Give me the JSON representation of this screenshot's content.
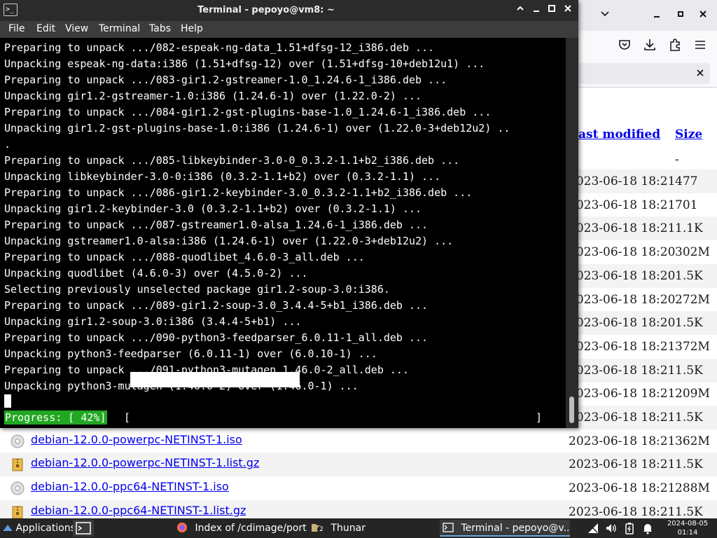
{
  "colors": {
    "terminal_bg": "#000000",
    "terminal_fg": "#ffffff",
    "progress_bg": "#22a722",
    "link": "#0000ee",
    "taskbar_bg": "#252525"
  },
  "browser": {
    "headers": {
      "last_modified": "ast modified",
      "size": "Size"
    },
    "parent_size": "-",
    "rows": [
      {
        "name": "",
        "date": "2023-06-18 18:21",
        "size": "477",
        "icon": "file-icon"
      },
      {
        "name": "",
        "date": "2023-06-18 18:21",
        "size": "701",
        "icon": "file-icon"
      },
      {
        "name": "",
        "date": "2023-06-18 18:21",
        "size": "1.1K",
        "icon": "file-icon"
      },
      {
        "name": "",
        "date": "2023-06-18 18:20",
        "size": "302M",
        "icon": "file-icon"
      },
      {
        "name": "",
        "date": "2023-06-18 18:20",
        "size": "1.5K",
        "icon": "file-icon"
      },
      {
        "name": "",
        "date": "2023-06-18 18:20",
        "size": "272M",
        "icon": "file-icon"
      },
      {
        "name": "",
        "date": "2023-06-18 18:20",
        "size": "1.5K",
        "icon": "file-icon"
      },
      {
        "name": "",
        "date": "2023-06-18 18:21",
        "size": "372M",
        "icon": "file-icon"
      },
      {
        "name": "",
        "date": "2023-06-18 18:21",
        "size": "1.5K",
        "icon": "file-icon"
      },
      {
        "name": "",
        "date": "2023-06-18 18:21",
        "size": "209M",
        "icon": "file-icon"
      },
      {
        "name": "",
        "date": "2023-06-18 18:21",
        "size": "1.5K",
        "icon": "file-icon"
      },
      {
        "name": "debian-12.0.0-powerpc-NETINST-1.iso",
        "date": "2023-06-18 18:21",
        "size": "362M",
        "icon": "disc-icon"
      },
      {
        "name": "debian-12.0.0-powerpc-NETINST-1.list.gz",
        "date": "2023-06-18 18:21",
        "size": "1.5K",
        "icon": "archive-icon"
      },
      {
        "name": "debian-12.0.0-ppc64-NETINST-1.iso",
        "date": "2023-06-18 18:21",
        "size": "288M",
        "icon": "disc-icon"
      },
      {
        "name": "debian-12.0.0-ppc64-NETINST-1.list.gz",
        "date": "2023-06-18 18:21",
        "size": "1.5K",
        "icon": "archive-icon"
      }
    ]
  },
  "terminal": {
    "title": "Terminal - pepoyo@vm8: ~",
    "menu": [
      "File",
      "Edit",
      "View",
      "Terminal",
      "Tabs",
      "Help"
    ],
    "lines": [
      "Preparing to unpack .../082-espeak-ng-data_1.51+dfsg-12_i386.deb ...",
      "Unpacking espeak-ng-data:i386 (1.51+dfsg-12) over (1.51+dfsg-10+deb12u1) ...",
      "Preparing to unpack .../083-gir1.2-gstreamer-1.0_1.24.6-1_i386.deb ...",
      "Unpacking gir1.2-gstreamer-1.0:i386 (1.24.6-1) over (1.22.0-2) ...",
      "Preparing to unpack .../084-gir1.2-gst-plugins-base-1.0_1.24.6-1_i386.deb ...",
      "Unpacking gir1.2-gst-plugins-base-1.0:i386 (1.24.6-1) over (1.22.0-3+deb12u2) ..",
      ".",
      "Preparing to unpack .../085-libkeybinder-3.0-0_0.3.2-1.1+b2_i386.deb ...",
      "Unpacking libkeybinder-3.0-0:i386 (0.3.2-1.1+b2) over (0.3.2-1.1) ...",
      "Preparing to unpack .../086-gir1.2-keybinder-3.0_0.3.2-1.1+b2_i386.deb ...",
      "Unpacking gir1.2-keybinder-3.0 (0.3.2-1.1+b2) over (0.3.2-1.1) ...",
      "Preparing to unpack .../087-gstreamer1.0-alsa_1.24.6-1_i386.deb ...",
      "Unpacking gstreamer1.0-alsa:i386 (1.24.6-1) over (1.22.0-3+deb12u2) ...",
      "Preparing to unpack .../088-quodlibet_4.6.0-3_all.deb ...",
      "Unpacking quodlibet (4.6.0-3) over (4.5.0-2) ...",
      "Selecting previously unselected package gir1.2-soup-3.0:i386.",
      "Preparing to unpack .../089-gir1.2-soup-3.0_3.4.4-5+b1_i386.deb ...",
      "Unpacking gir1.2-soup-3.0:i386 (3.4.4-5+b1) ...",
      "Preparing to unpack .../090-python3-feedparser_6.0.11-1_all.deb ...",
      "Unpacking python3-feedparser (6.0.11-1) over (6.0.10-1) ...",
      "Preparing to unpack .../091-python3-mutagen_1.46.0-2_all.deb ...",
      "Unpacking python3-mutagen (1.46.0-2) over (1.46.0-1) ..."
    ],
    "progress_label": "Progress: [ 42%]",
    "progress_fraction": 0.42,
    "bracket_open": "[",
    "bracket_close": "]"
  },
  "taskbar": {
    "applications": "Applications",
    "windows": [
      {
        "label": "Index of /cdimage/port...",
        "icon": "firefox-icon"
      },
      {
        "label": "Thunar",
        "icon": "folder-icon"
      },
      {
        "label": "Terminal - pepoyo@v...",
        "icon": "terminal-icon"
      }
    ],
    "workspace_badge": "2",
    "date": "2024-08-05",
    "time": "01:14"
  }
}
